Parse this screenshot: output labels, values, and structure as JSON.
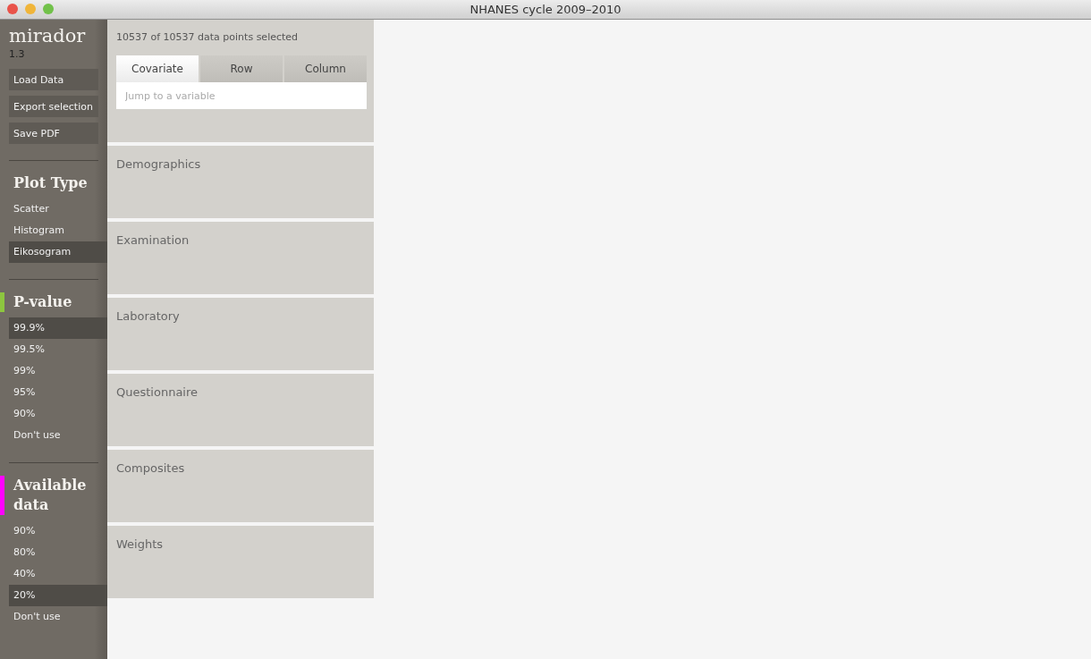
{
  "window": {
    "title": "NHANES cycle 2009–2010"
  },
  "sidebar": {
    "app_name": "mirador",
    "version": "1.3",
    "buttons": [
      "Load Data",
      "Export selection",
      "Save PDF"
    ],
    "sections": [
      {
        "title": "Plot Type",
        "items": [
          {
            "label": "Scatter",
            "selected": false
          },
          {
            "label": "Histogram",
            "selected": false
          },
          {
            "label": "Eikosogram",
            "selected": true
          }
        ]
      },
      {
        "title": "P-value",
        "color": "#8dc63f",
        "items": [
          {
            "label": "99.9%",
            "selected": true
          },
          {
            "label": "99.5%",
            "selected": false
          },
          {
            "label": "99%",
            "selected": false
          },
          {
            "label": "95%",
            "selected": false
          },
          {
            "label": "90%",
            "selected": false
          },
          {
            "label": "Don't use",
            "selected": false
          }
        ]
      },
      {
        "title": "Available data",
        "color": "#ff00ff",
        "items": [
          {
            "label": "90%",
            "selected": false
          },
          {
            "label": "80%",
            "selected": false
          },
          {
            "label": "40%",
            "selected": false
          },
          {
            "label": "20%",
            "selected": true
          },
          {
            "label": "Don't use",
            "selected": false
          }
        ]
      }
    ]
  },
  "variables": {
    "selection_summary": "10537 of 10537 data points selected",
    "tabs": [
      {
        "label": "Covariate",
        "selected": true
      },
      {
        "label": "Row",
        "selected": false
      },
      {
        "label": "Column",
        "selected": false
      }
    ],
    "search": {
      "placeholder": "Jump to a variable"
    },
    "categories": [
      "Demographics",
      "Examination",
      "Laboratory",
      "Questionnaire",
      "Composites",
      "Weights"
    ]
  }
}
